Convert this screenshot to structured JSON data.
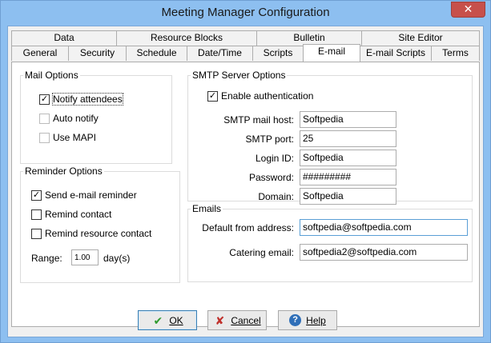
{
  "window": {
    "title": "Meeting Manager Configuration",
    "close_glyph": "✕"
  },
  "tabs_row1": [
    "Data",
    "Resource Blocks",
    "Bulletin",
    "Site Editor"
  ],
  "tabs_row2": [
    "General",
    "Security",
    "Schedule",
    "Date/Time",
    "Scripts",
    "E-mail",
    "E-mail Scripts",
    "Terms"
  ],
  "active_tab": "E-mail",
  "mail_options": {
    "title": "Mail Options",
    "notify_attendees": {
      "label": "Notify attendees",
      "checked": true
    },
    "auto_notify": {
      "label": "Auto notify",
      "checked": false
    },
    "use_mapi": {
      "label": "Use MAPI",
      "checked": false
    }
  },
  "reminder_options": {
    "title": "Reminder Options",
    "send_reminder": {
      "label": "Send e-mail reminder",
      "checked": true
    },
    "remind_contact": {
      "label": "Remind contact",
      "checked": false
    },
    "remind_resource_contact": {
      "label": "Remind resource contact",
      "checked": false
    },
    "range_label": "Range:",
    "range_value": "1.00",
    "range_unit": "day(s)"
  },
  "smtp": {
    "title": "SMTP Server Options",
    "enable_auth": {
      "label": "Enable authentication",
      "checked": true
    },
    "host_label": "SMTP mail host:",
    "host_value": "Softpedia",
    "port_label": "SMTP port:",
    "port_value": "25",
    "login_label": "Login ID:",
    "login_value": "Softpedia",
    "password_label": "Password:",
    "password_value": "#########",
    "domain_label": "Domain:",
    "domain_value": "Softpedia"
  },
  "emails": {
    "title": "Emails",
    "default_from_label": "Default from address:",
    "default_from_value": "softpedia@softpedia.com",
    "catering_label": "Catering email:",
    "catering_value": "softpedia2@softpedia.com"
  },
  "buttons": {
    "ok": "OK",
    "cancel": "Cancel",
    "help": "Help"
  },
  "colors": {
    "accent": "#3c7fb1",
    "frame": "#8dbff0",
    "close": "#c7504b"
  }
}
